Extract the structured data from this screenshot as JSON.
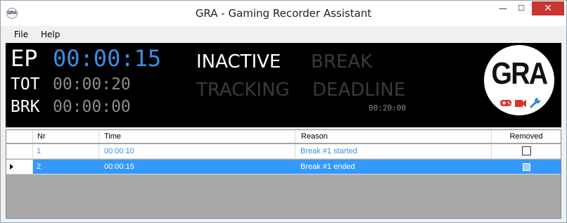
{
  "window": {
    "title": "GRA - Gaming Recorder Assistant",
    "icon_text": "GRA",
    "controls": {
      "minimize": "—",
      "maximize": "☐",
      "close": "✕"
    }
  },
  "menu": {
    "items": [
      "File",
      "Help"
    ]
  },
  "clocks": {
    "ep": {
      "label": "EP",
      "value": "00:00:15"
    },
    "tot": {
      "label": "TOT",
      "value": "00:00:20"
    },
    "brk": {
      "label": "BRK",
      "value": "00:00:00"
    }
  },
  "status": {
    "inactive": "INACTIVE",
    "break": "BREAK",
    "tracking": "TRACKING",
    "deadline": "DEADLINE",
    "deadline_time": "00:20:00"
  },
  "logo": {
    "text": "GRA",
    "icons": [
      "gamepad-icon",
      "camera-icon",
      "wrench-icon"
    ]
  },
  "table": {
    "columns": [
      "Nr",
      "Time",
      "Reason",
      "Removed"
    ],
    "rows": [
      {
        "nr": "1",
        "time": "00:00:10",
        "reason": "Break #1 started",
        "removed": false,
        "selected": false
      },
      {
        "nr": "2",
        "time": "00:00:15",
        "reason": "Break #1 ended",
        "removed": false,
        "selected": true
      }
    ]
  },
  "colors": {
    "accent_blue": "#3a8ee6",
    "selection": "#3399ff",
    "inactive_gray": "#3a3a3a",
    "logo_red": "#d9342b",
    "logo_blue": "#2d8ad6",
    "close_red": "#c7372f"
  }
}
